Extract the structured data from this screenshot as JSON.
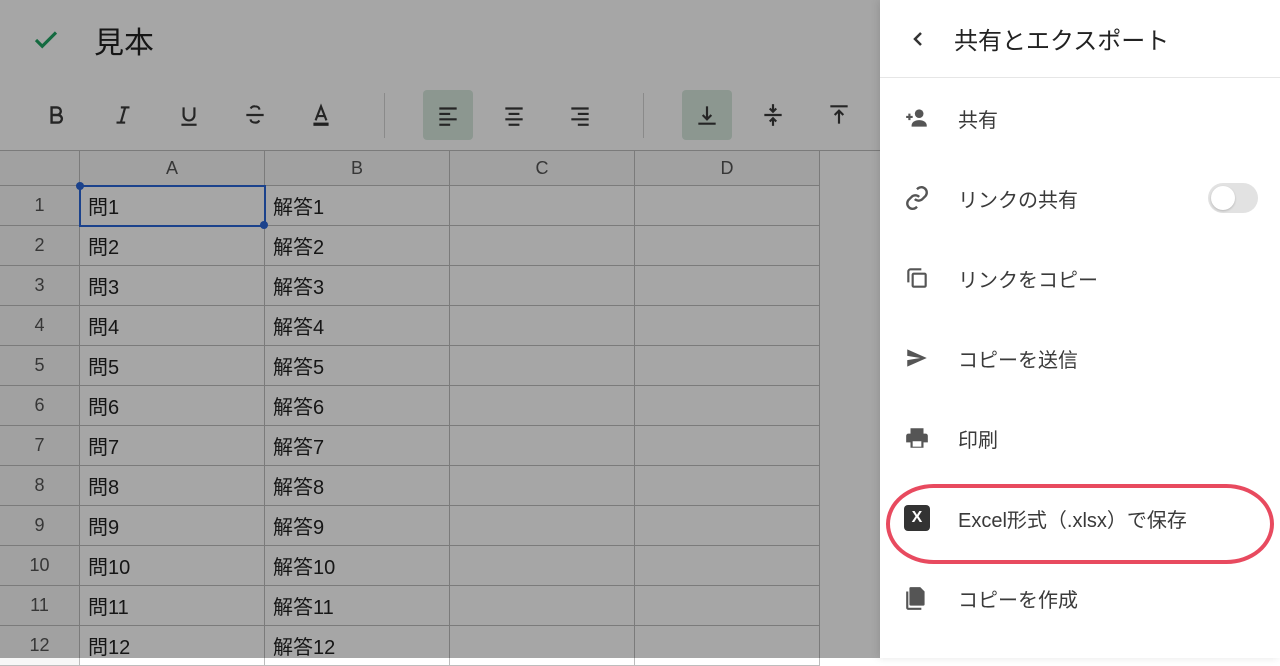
{
  "header": {
    "title": "見本"
  },
  "columns": [
    "A",
    "B",
    "C",
    "D"
  ],
  "rows": [
    {
      "n": "1",
      "a": "問1",
      "b": "解答1"
    },
    {
      "n": "2",
      "a": "問2",
      "b": "解答2"
    },
    {
      "n": "3",
      "a": "問3",
      "b": "解答3"
    },
    {
      "n": "4",
      "a": "問4",
      "b": "解答4"
    },
    {
      "n": "5",
      "a": "問5",
      "b": "解答5"
    },
    {
      "n": "6",
      "a": "問6",
      "b": "解答6"
    },
    {
      "n": "7",
      "a": "問7",
      "b": "解答7"
    },
    {
      "n": "8",
      "a": "問8",
      "b": "解答8"
    },
    {
      "n": "9",
      "a": "問9",
      "b": "解答9"
    },
    {
      "n": "10",
      "a": "問10",
      "b": "解答10"
    },
    {
      "n": "11",
      "a": "問11",
      "b": "解答11"
    },
    {
      "n": "12",
      "a": "問12",
      "b": "解答12"
    }
  ],
  "panel": {
    "title": "共有とエクスポート",
    "share": "共有",
    "link_share": "リンクの共有",
    "copy_link": "リンクをコピー",
    "send_copy": "コピーを送信",
    "print": "印刷",
    "save_xlsx": "Excel形式（.xlsx）で保存",
    "make_copy": "コピーを作成",
    "x_badge": "X"
  }
}
